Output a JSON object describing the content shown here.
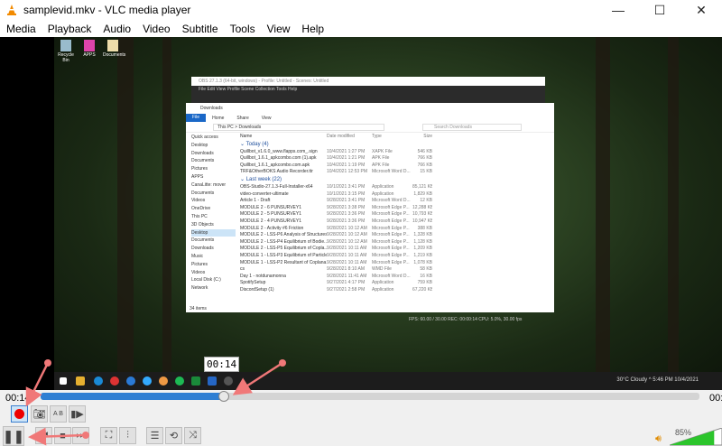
{
  "window": {
    "title": "samplevid.mkv - VLC media player",
    "minimize": "—",
    "maximize": "☐",
    "close": "✕"
  },
  "menu": [
    "Media",
    "Playback",
    "Audio",
    "Video",
    "Subtitle",
    "Tools",
    "View",
    "Help"
  ],
  "video_content": {
    "desktop_icons": [
      "Recycle Bin",
      "APPS",
      "Documents"
    ],
    "obs_title": "OBS 27.1.3 (64-bit, windows) - Profile: Untitled - Scenes: Untitled",
    "obs_menu": "File  Edit  View  Profile  Scene Collection  Tools  Help",
    "explorer": {
      "title": "Downloads",
      "ribbon": [
        "File",
        "Home",
        "Share",
        "View"
      ],
      "breadcrumb": "This PC  >  Downloads",
      "search_placeholder": "Search Downloads",
      "nav": [
        "Quick access",
        "Desktop",
        "Downloads",
        "Documents",
        "Pictures",
        "APPS",
        "CanaLitte: mover",
        "Documents",
        "Videos",
        "OneDrive",
        "This PC",
        "3D Objects",
        "Desktop",
        "Documents",
        "Downloads",
        "Music",
        "Pictures",
        "Videos",
        "Local Disk (C:)",
        "Network"
      ],
      "columns": [
        "Name",
        "Date modified",
        "Type",
        "Size"
      ],
      "groups": [
        {
          "label": "Today (4)",
          "files": [
            [
              "Quillbot_v1.6.0_www.flapps.com_.sign",
              "10/4/2021 1:27 PM",
              "XAPK File",
              "546 KB"
            ],
            [
              "Quillbot_1.6.1_apkcombo.com (1).apk",
              "10/4/2021 1:21 PM",
              "APK File",
              "766 KB"
            ],
            [
              "Quillbot_1.6.1_apkcombo.com.apk",
              "10/4/2021 1:19 PM",
              "APK File",
              "766 KB"
            ],
            [
              "TRF&OtherBOKS Audio Recorder.ttr",
              "10/4/2021 12:53 PM",
              "Microsoft Word D...",
              "15 KB"
            ]
          ]
        },
        {
          "label": "Last week (22)",
          "files": [
            [
              "OBS-Studio-27.1.3-Full-Installer-x64",
              "10/1/2021 3:41 PM",
              "Application",
              "85,121 KB"
            ],
            [
              "video-converter-ultimate",
              "10/1/2021 3:15 PM",
              "Application",
              "1,829 KB"
            ],
            [
              "Article 1 - Draft",
              "9/28/2021 3:41 PM",
              "Microsoft Word D...",
              "12 KB"
            ],
            [
              "MODULE 2 - 6 PUNSURVEY1",
              "9/28/2021 3:38 PM",
              "Microsoft Edge P...",
              "12,288 KB"
            ],
            [
              "MODULE 2 - 5 PUNSURVEY1",
              "9/28/2021 3:36 PM",
              "Microsoft Edge P...",
              "10,793 KB"
            ],
            [
              "MODULE 2 - 4 PUNSURVEY1",
              "9/28/2021 3:36 PM",
              "Microsoft Edge P...",
              "10,947 KB"
            ],
            [
              "MODULE 2 - Activity #6 Friction",
              "9/28/2021 10:12 AM",
              "Microsoft Edge P...",
              "388 KB"
            ],
            [
              "MODULE 2 - LSS-P6 Analysis of Structures",
              "9/28/2021 10:12 AM",
              "Microsoft Edge P...",
              "1,328 KB"
            ],
            [
              "MODULE 2 - LSS-P4 Equilibrium of Bodie...",
              "9/28/2021 10:12 AM",
              "Microsoft Edge P...",
              "1,128 KB"
            ],
            [
              "MODULE 2 - LSS-P5 Equilibrium of Copla...",
              "9/28/2021 10:11 AM",
              "Microsoft Edge P...",
              "1,209 KB"
            ],
            [
              "MODULE 1 - LSS-P3 Equilibrium of Particle",
              "9/28/2021 10:11 AM",
              "Microsoft Edge P...",
              "1,219 KB"
            ],
            [
              "MODULE 1 - LSS-P2 Resultant of Coplana...",
              "9/28/2021 10:11 AM",
              "Microsoft Edge P...",
              "1,078 KB"
            ],
            [
              "cs",
              "9/28/2021 8:10 AM",
              "WMD File",
              "58 KB"
            ],
            [
              "Day 1 - notdunamonna",
              "9/28/2021 11:41 AM",
              "Microsoft Word D...",
              "16 KB"
            ],
            [
              "SpotifySetup",
              "9/27/2021 4:17 PM",
              "Application",
              "759 KB"
            ],
            [
              "DiscordSetup (1)",
              "9/27/2021 2:58 PM",
              "Application",
              "67,220 KB"
            ]
          ]
        }
      ],
      "status": "34 items"
    },
    "obs_status": "FPS: 60.00 / 30.00    REC: 00:00:14    CPU: 5.0%, 30.00 fps",
    "taskbar_tray": "30°C  Cloudy   ^     5:46 PM  10/4/2021"
  },
  "tooltip": "00:14",
  "playback": {
    "elapsed": "00:14",
    "remaining": "00:",
    "progress_percent": 27.8
  },
  "buttons": {
    "record": "record",
    "snapshot": "snapshot",
    "ab_loop": "A B",
    "frame_step": "frame",
    "pause": "pause",
    "previous": "previous",
    "stop": "stop",
    "next": "next",
    "fullscreen": "fullscreen",
    "extended": "extended settings",
    "playlist": "playlist",
    "loop": "loop",
    "shuffle": "shuffle"
  },
  "volume": {
    "label": "85%",
    "percent": 85
  },
  "colors": {
    "accent": "#2f7fd3",
    "record": "#e00000",
    "volume": "#2cc52c",
    "annotation": "#f07878"
  }
}
